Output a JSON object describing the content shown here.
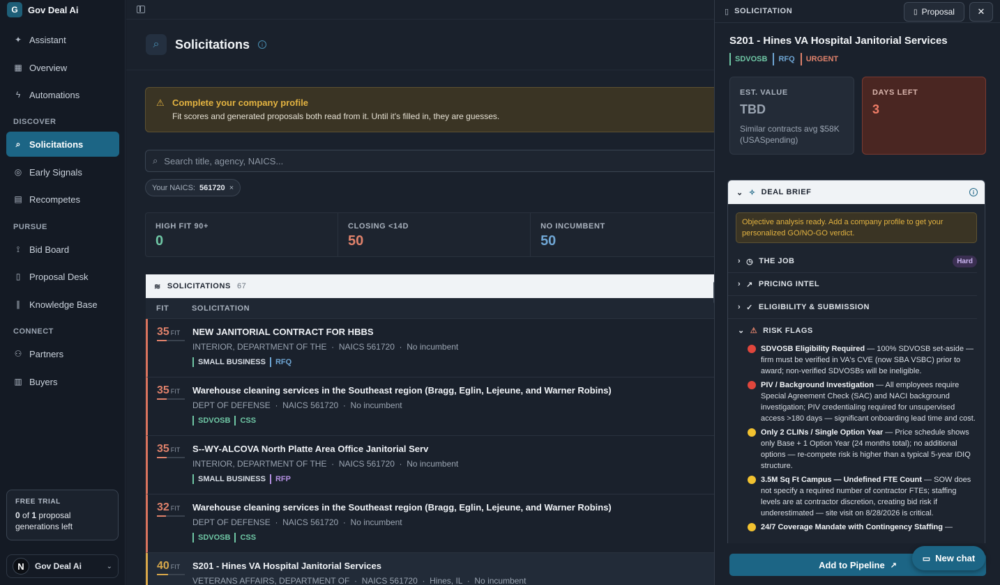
{
  "app": {
    "name": "Gov Deal Ai",
    "logo_letter": "G"
  },
  "sidebar": {
    "items": [
      {
        "label": "Assistant",
        "icon": "sparkle-icon"
      },
      {
        "label": "Overview",
        "icon": "grid-icon"
      },
      {
        "label": "Automations",
        "icon": "bolt-icon"
      }
    ],
    "sections": [
      "DISCOVER",
      "PURSUE",
      "CONNECT"
    ],
    "discover": [
      {
        "label": "Solicitations",
        "icon": "search-icon",
        "active": true
      },
      {
        "label": "Early Signals",
        "icon": "radar-icon"
      },
      {
        "label": "Recompetes",
        "icon": "archive-icon"
      }
    ],
    "pursue": [
      {
        "label": "Bid Board",
        "icon": "route-icon"
      },
      {
        "label": "Proposal Desk",
        "icon": "file-icon"
      },
      {
        "label": "Knowledge Base",
        "icon": "library-icon"
      }
    ],
    "connect": [
      {
        "label": "Partners",
        "icon": "users-icon"
      },
      {
        "label": "Buyers",
        "icon": "building-icon"
      }
    ],
    "trial": {
      "title": "FREE TRIAL",
      "count_used": "0",
      "of": "of",
      "count_total": "1",
      "text_a": "proposal",
      "text_b": "generations left"
    },
    "user": {
      "initial": "N",
      "name": "Gov Deal Ai"
    }
  },
  "header": {
    "title": "Solicitations"
  },
  "banner": {
    "title": "Complete your company profile",
    "text": "Fit scores and generated proposals both read from it. Until it's filled in, they are guesses."
  },
  "search": {
    "placeholder": "Search title, agency, NAICS..."
  },
  "chip": {
    "label": "Your NAICS:",
    "value": "561720"
  },
  "stats": [
    {
      "label": "HIGH FIT 90+",
      "value": "0",
      "color": "#6fc7a5"
    },
    {
      "label": "CLOSING <14D",
      "value": "50",
      "color": "#e0826b"
    },
    {
      "label": "NO INCUMBENT",
      "value": "50",
      "color": "#6fa6d4"
    }
  ],
  "list": {
    "title": "SOLICITATIONS",
    "count": "67",
    "col_fit": "FIT",
    "col_sol": "SOLICITATION",
    "fit_suffix": "FIT",
    "rows": [
      {
        "fit": "35",
        "title": "NEW JANITORIAL CONTRACT FOR HBBS",
        "agency": "INTERIOR, DEPARTMENT OF THE",
        "naics": "NAICS 561720",
        "inc": "No incumbent",
        "tags": [
          "SMALL BUSINESS",
          "RFQ"
        ]
      },
      {
        "fit": "35",
        "title": "Warehouse cleaning services in the Southeast region (Bragg, Eglin, Lejeune, and Warner Robins)",
        "agency": "DEPT OF DEFENSE",
        "naics": "NAICS 561720",
        "inc": "No incumbent",
        "tags": [
          "SDVOSB",
          "CSS"
        ]
      },
      {
        "fit": "35",
        "title": "S--WY-ALCOVA North Platte Area Office Janitorial Serv",
        "agency": "INTERIOR, DEPARTMENT OF THE",
        "naics": "NAICS 561720",
        "inc": "No incumbent",
        "tags": [
          "SMALL BUSINESS",
          "RFP"
        ]
      },
      {
        "fit": "32",
        "title": "Warehouse cleaning services in the Southeast region (Bragg, Eglin, Lejeune, and Warner Robins)",
        "agency": "DEPT OF DEFENSE",
        "naics": "NAICS 561720",
        "inc": "No incumbent",
        "tags": [
          "SDVOSB",
          "CSS"
        ]
      },
      {
        "fit": "40",
        "title": "S201 - Hines VA Hospital Janitorial Services",
        "agency": "VETERANS AFFAIRS, DEPARTMENT OF",
        "naics": "NAICS 561720",
        "loc": "Hines, IL",
        "inc": "No incumbent",
        "tags": []
      }
    ]
  },
  "panel": {
    "label": "SOLICITATION",
    "proposal_btn": "Proposal",
    "title": "S201 - Hines VA Hospital Janitorial Services",
    "tags": [
      {
        "t": "SDVOSB",
        "c": "#6fc7a5"
      },
      {
        "t": "RFQ",
        "c": "#6fa6d4"
      },
      {
        "t": "URGENT",
        "c": "#e0826b"
      }
    ],
    "est": {
      "label": "EST. VALUE",
      "value": "TBD",
      "sub": "Similar contracts avg $58K (USASpending)"
    },
    "days": {
      "label": "DAYS LEFT",
      "value": "3"
    },
    "brief": {
      "title": "DEAL BRIEF",
      "note": "Objective analysis ready. Add a company profile to get your personalized GO/NO-GO verdict.",
      "sections": [
        "THE JOB",
        "PRICING INTEL",
        "ELIGIBILITY & SUBMISSION",
        "RISK FLAGS"
      ],
      "hard": "Hard",
      "risks": [
        {
          "color": "#e0463c",
          "title": "SDVOSB Eligibility Required",
          "text": " — 100% SDVOSB set-aside — firm must be verified in VA's CVE (now SBA VSBC) prior to award; non-verified SDVOSBs will be ineligible."
        },
        {
          "color": "#e0463c",
          "title": "PIV / Background Investigation",
          "text": " — All employees require Special Agreement Check (SAC) and NACI background investigation; PIV credentialing required for unsupervised access >180 days — significant onboarding lead time and cost."
        },
        {
          "color": "#f2c230",
          "title": "Only 2 CLINs / Single Option Year",
          "text": " — Price schedule shows only Base + 1 Option Year (24 months total); no additional options — re-compete risk is higher than a typical 5-year IDIQ structure."
        },
        {
          "color": "#f2c230",
          "title": "3.5M Sq Ft Campus — Undefined FTE Count",
          "text": " — SOW does not specify a required number of contractor FTEs; staffing levels are at contractor discretion, creating bid risk if underestimated — site visit on 8/28/2026 is critical."
        },
        {
          "color": "#f2c230",
          "title": "24/7 Coverage Mandate with Contingency Staffing",
          "text": " —"
        }
      ]
    },
    "pipeline_btn": "Add to Pipeline",
    "chat_btn": "New chat"
  }
}
